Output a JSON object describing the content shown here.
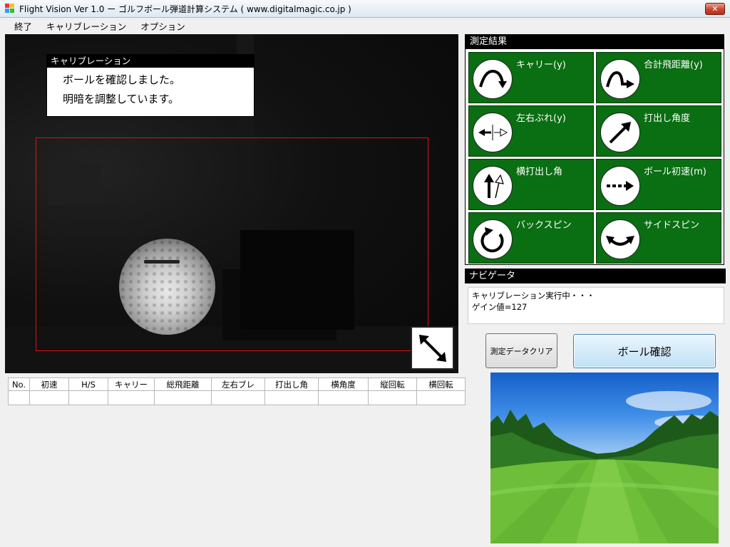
{
  "window": {
    "title": "Flight Vision  Ver 1.0  ー ゴルフボール弾道計算システム  ( www.digitalmagic.co.jp )",
    "close_label": "✕"
  },
  "menu": [
    "終了",
    "キャリブレーション",
    "オプション"
  ],
  "calibration": {
    "title": "キャリブレーション",
    "lines": [
      "ボールを確認しました。",
      "明暗を調整しています。"
    ]
  },
  "table": {
    "headers": [
      "No.",
      "初速",
      "H/S",
      "キャリー",
      "総飛距離",
      "左右ブレ",
      "打出し角",
      "横角度",
      "縦回転",
      "横回転"
    ],
    "rows": [
      [
        "",
        "",
        "",
        "",
        "",
        "",
        "",
        "",
        "",
        ""
      ]
    ]
  },
  "results": {
    "title": "測定結果",
    "tiles": [
      {
        "label": "キャリー(y)",
        "icon": "carry-arc-icon"
      },
      {
        "label": "合計飛距離(y)",
        "icon": "total-distance-icon"
      },
      {
        "label": "左右ぶれ(y)",
        "icon": "lateral-deviation-icon"
      },
      {
        "label": "打出し角度",
        "icon": "launch-angle-icon"
      },
      {
        "label": "横打出し角",
        "icon": "side-launch-icon"
      },
      {
        "label": "ボール初速(m)",
        "icon": "ball-speed-icon"
      },
      {
        "label": "バックスピン",
        "icon": "backspin-icon"
      },
      {
        "label": "サイドスピン",
        "icon": "sidespin-icon"
      }
    ]
  },
  "navigator": {
    "title": "ナビゲータ",
    "lines": [
      "キャリブレーション実行中・・・",
      "ゲイン値=127"
    ]
  },
  "buttons": {
    "clear": "測定データクリア",
    "confirm": "ボール確認"
  },
  "colors": {
    "tile_green": "#0a6e12",
    "roi_red": "#e01010"
  }
}
